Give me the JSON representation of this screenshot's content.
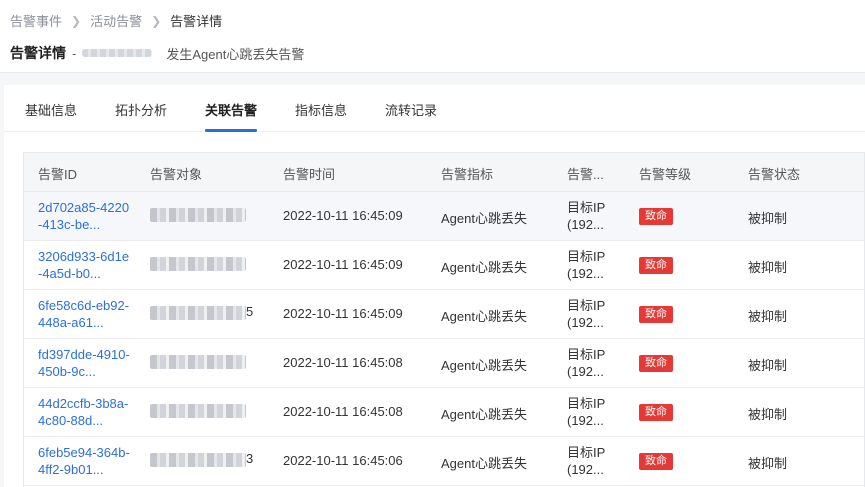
{
  "breadcrumb": [
    "告警事件",
    "活动告警",
    "告警详情"
  ],
  "header": {
    "title": "告警详情",
    "dash": "-",
    "description": "发生Agent心跳丢失告警"
  },
  "tabs": [
    {
      "label": "基础信息"
    },
    {
      "label": "拓扑分析"
    },
    {
      "label": "关联告警",
      "active": true
    },
    {
      "label": "指标信息"
    },
    {
      "label": "流转记录"
    }
  ],
  "table": {
    "columns": [
      "告警ID",
      "告警对象",
      "告警时间",
      "告警指标",
      "告警...",
      "告警等级",
      "告警状态"
    ],
    "rows": [
      {
        "id": "2d702a85-4220-413c-be...",
        "obj_suffix": "",
        "time": "2022-10-11 16:45:09",
        "metric": "Agent心跳丢失",
        "target_line1": "目标IP",
        "target_line2": "(192...",
        "level": "致命",
        "status": "被抑制"
      },
      {
        "id": "3206d933-6d1e-4a5d-b0...",
        "obj_suffix": "",
        "time": "2022-10-11 16:45:09",
        "metric": "Agent心跳丢失",
        "target_line1": "目标IP",
        "target_line2": "(192...",
        "level": "致命",
        "status": "被抑制"
      },
      {
        "id": "6fe58c6d-eb92-448a-a61...",
        "obj_suffix": "5",
        "time": "2022-10-11 16:45:09",
        "metric": "Agent心跳丢失",
        "target_line1": "目标IP",
        "target_line2": "(192...",
        "level": "致命",
        "status": "被抑制"
      },
      {
        "id": "fd397dde-4910-450b-9c...",
        "obj_suffix": "",
        "time": "2022-10-11 16:45:08",
        "metric": "Agent心跳丢失",
        "target_line1": "目标IP",
        "target_line2": "(192...",
        "level": "致命",
        "status": "被抑制"
      },
      {
        "id": "44d2ccfb-3b8a-4c80-88d...",
        "obj_suffix": "",
        "time": "2022-10-11 16:45:08",
        "metric": "Agent心跳丢失",
        "target_line1": "目标IP",
        "target_line2": "(192...",
        "level": "致命",
        "status": "被抑制"
      },
      {
        "id": "6feb5e94-364b-4ff2-9b01...",
        "obj_suffix": "3",
        "time": "2022-10-11 16:45:06",
        "metric": "Agent心跳丢失",
        "target_line1": "目标IP",
        "target_line2": "(192...",
        "level": "致命",
        "status": "被抑制"
      }
    ]
  },
  "colors": {
    "accent": "#2b6fdc",
    "danger": "#e53935"
  }
}
